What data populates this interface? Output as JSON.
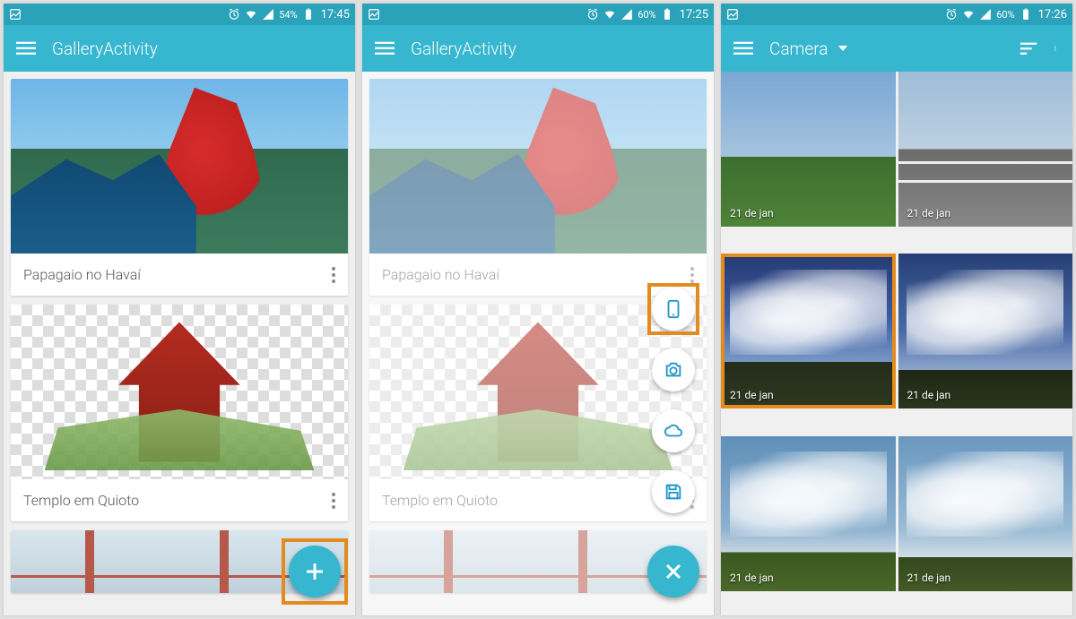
{
  "screen1": {
    "status": {
      "battery_pct": "54%",
      "time": "17:45"
    },
    "appbar": {
      "title": "GalleryActivity"
    },
    "cards": [
      {
        "title": "Papagaio no Havaí"
      },
      {
        "title": "Templo em Quioto"
      }
    ],
    "fab_icon": "plus"
  },
  "screen2": {
    "status": {
      "battery_pct": "60%",
      "time": "17:25"
    },
    "appbar": {
      "title": "GalleryActivity"
    },
    "cards": [
      {
        "title": "Papagaio no Havaí"
      },
      {
        "title": "Templo em Quioto"
      }
    ],
    "fab_icon": "close",
    "actions": [
      {
        "name": "from-device",
        "icon": "phone",
        "highlighted": true
      },
      {
        "name": "from-camera",
        "icon": "camera",
        "highlighted": false
      },
      {
        "name": "from-creative-cloud",
        "icon": "cloud",
        "highlighted": false
      },
      {
        "name": "from-library",
        "icon": "save",
        "highlighted": false
      }
    ]
  },
  "screen3": {
    "status": {
      "battery_pct": "60%",
      "time": "17:26"
    },
    "appbar": {
      "title": "Camera"
    },
    "tiles": [
      {
        "date": "21 de jan",
        "selected": false
      },
      {
        "date": "21 de jan",
        "selected": false
      },
      {
        "date": "21 de jan",
        "selected": true
      },
      {
        "date": "21 de jan",
        "selected": false
      },
      {
        "date": "21 de jan",
        "selected": false
      },
      {
        "date": "21 de jan",
        "selected": false
      }
    ]
  }
}
